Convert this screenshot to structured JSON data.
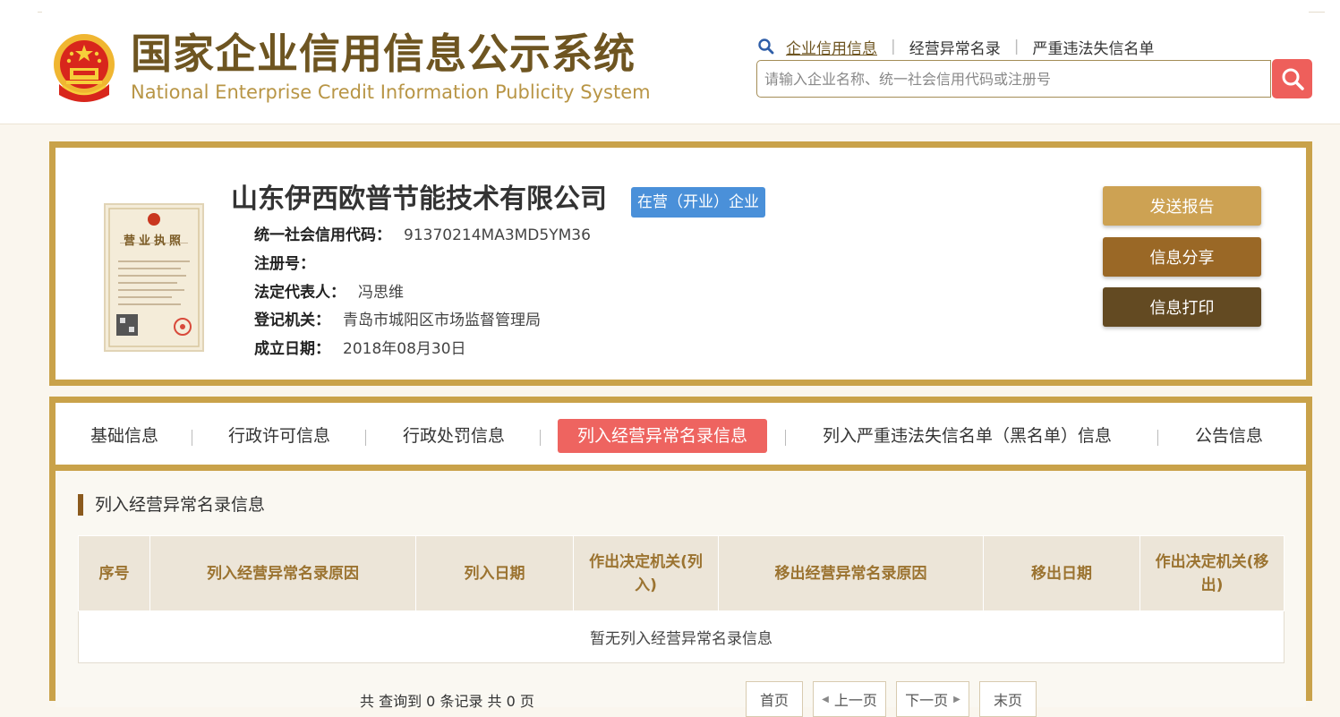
{
  "header": {
    "logo_cn": "国家企业信用信息公示系统",
    "logo_en": "National Enterprise Credit Information Publicity System",
    "links": [
      "企业信用信息",
      "经营异常名录",
      "严重违法失信名单"
    ],
    "search_placeholder": "请输入企业名称、统一社会信用代码或注册号",
    "brand_color": "#6e5521",
    "accent_red": "#ee5f5b"
  },
  "company": {
    "name": "山东伊西欧普节能技术有限公司",
    "status": "在营（开业）企业",
    "license_title": "营业执照",
    "fields": [
      {
        "label": "统一社会信用代码：",
        "value": "91370214MA3MD5YM36"
      },
      {
        "label": "注册号：",
        "value": ""
      },
      {
        "label": "法定代表人：",
        "value": "冯思维"
      },
      {
        "label": "登记机关：",
        "value": "青岛市城阳区市场监督管理局"
      },
      {
        "label": "成立日期：",
        "value": "2018年08月30日"
      }
    ],
    "actions": [
      {
        "label": "发送报告",
        "color": "#cda253"
      },
      {
        "label": "信息分享",
        "color": "#9a6826"
      },
      {
        "label": "信息打印",
        "color": "#634a22"
      }
    ]
  },
  "tabs": [
    "基础信息",
    "行政许可信息",
    "行政处罚信息",
    "列入经营异常名录信息",
    "列入严重违法失信名单（黑名单）信息",
    "公告信息"
  ],
  "section": {
    "title": "列入经营异常名录信息",
    "columns": [
      "序号",
      "列入经营异常名录原因",
      "列入日期",
      "作出决定机关(列入)",
      "移出经营异常名录原因",
      "移出日期",
      "作出决定机关(移出)"
    ],
    "empty_text": "暂无列入经营异常名录信息"
  },
  "pager": {
    "summary": "共 查询到 0 条记录 共 0 页",
    "first": "首页",
    "prev": "上一页",
    "next": "下一页",
    "last": "末页"
  }
}
